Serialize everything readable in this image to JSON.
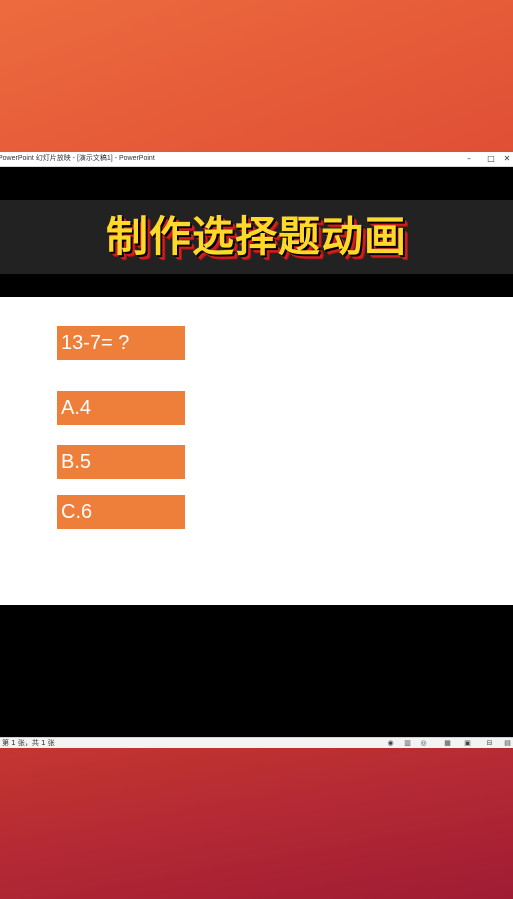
{
  "app": {
    "window_title": "PowerPoint 幻灯片放映 - [演示文稿1] - PowerPoint",
    "controls": {
      "minimize": "–",
      "maximize": "□",
      "close": "✕"
    }
  },
  "banner": {
    "text": "制作选择题动画"
  },
  "slide": {
    "question": "13-7= ?",
    "options": [
      "A.4",
      "B.5",
      "C.6"
    ]
  },
  "status": {
    "slide_info": "第 1 张，共 1 张",
    "icons": [
      "previous-icon",
      "menu-icon",
      "pen-icon",
      "slide-grid-icon",
      "zoom-icon",
      "more-icon"
    ]
  },
  "colors": {
    "accent": "#ee7f3a",
    "banner_text": "#ffd92a",
    "banner_shadow": "#d21f1f",
    "top_background": "#e55a38",
    "bottom_background": "#b12734"
  }
}
